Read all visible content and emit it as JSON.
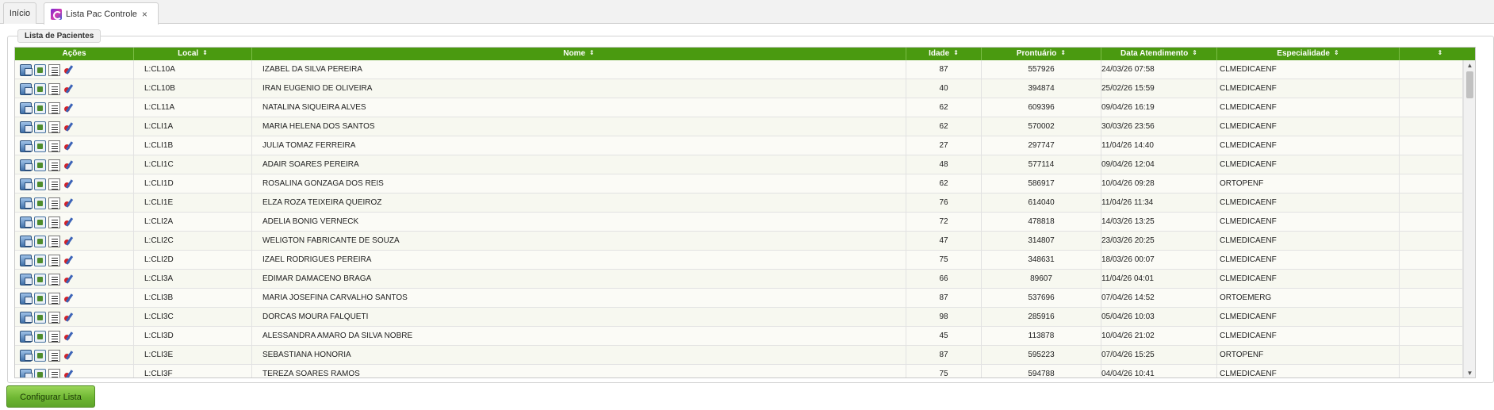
{
  "tabs": [
    {
      "label": "Início"
    },
    {
      "label": "Lista Pac Controle",
      "close": "×"
    }
  ],
  "panel": {
    "legend": "Lista de Pacientes"
  },
  "grid": {
    "columns": [
      {
        "label": "Ações"
      },
      {
        "label": "Local",
        "sort": "⇕"
      },
      {
        "label": "Nome",
        "sort": "⇕"
      },
      {
        "label": "Idade",
        "sort": "⇕"
      },
      {
        "label": "Prontuário",
        "sort": "⇕"
      },
      {
        "label": "Data Atendimento",
        "sort": "⇕"
      },
      {
        "label": "Especialidade",
        "sort": "⇕"
      },
      {
        "label": "",
        "sort": "⇕"
      }
    ],
    "rows": [
      {
        "local": "L:CL10A",
        "nome": "IZABEL DA SILVA PEREIRA",
        "idade": "87",
        "prontuario": "557926",
        "data": "24/03/26 07:58",
        "especialidade": "CLMEDICAENF"
      },
      {
        "local": "L:CL10B",
        "nome": "IRAN EUGENIO DE OLIVEIRA",
        "idade": "40",
        "prontuario": "394874",
        "data": "25/02/26 15:59",
        "especialidade": "CLMEDICAENF"
      },
      {
        "local": "L:CL11A",
        "nome": "NATALINA SIQUEIRA ALVES",
        "idade": "62",
        "prontuario": "609396",
        "data": "09/04/26 16:19",
        "especialidade": "CLMEDICAENF"
      },
      {
        "local": "L:CLI1A",
        "nome": "MARIA HELENA DOS SANTOS",
        "idade": "62",
        "prontuario": "570002",
        "data": "30/03/26 23:56",
        "especialidade": "CLMEDICAENF"
      },
      {
        "local": "L:CLI1B",
        "nome": "JULIA TOMAZ FERREIRA",
        "idade": "27",
        "prontuario": "297747",
        "data": "11/04/26 14:40",
        "especialidade": "CLMEDICAENF"
      },
      {
        "local": "L:CLI1C",
        "nome": "ADAIR SOARES PEREIRA",
        "idade": "48",
        "prontuario": "577114",
        "data": "09/04/26 12:04",
        "especialidade": "CLMEDICAENF"
      },
      {
        "local": "L:CLI1D",
        "nome": "ROSALINA GONZAGA DOS REIS",
        "idade": "62",
        "prontuario": "586917",
        "data": "10/04/26 09:28",
        "especialidade": "ORTOPENF"
      },
      {
        "local": "L:CLI1E",
        "nome": "ELZA ROZA TEIXEIRA QUEIROZ",
        "idade": "76",
        "prontuario": "614040",
        "data": "11/04/26 11:34",
        "especialidade": "CLMEDICAENF"
      },
      {
        "local": "L:CLI2A",
        "nome": "ADELIA BONIG VERNECK",
        "idade": "72",
        "prontuario": "478818",
        "data": "14/03/26 13:25",
        "especialidade": "CLMEDICAENF"
      },
      {
        "local": "L:CLI2C",
        "nome": "WELIGTON FABRICANTE DE SOUZA",
        "idade": "47",
        "prontuario": "314807",
        "data": "23/03/26 20:25",
        "especialidade": "CLMEDICAENF"
      },
      {
        "local": "L:CLI2D",
        "nome": "IZAEL RODRIGUES PEREIRA",
        "idade": "75",
        "prontuario": "348631",
        "data": "18/03/26 00:07",
        "especialidade": "CLMEDICAENF"
      },
      {
        "local": "L:CLI3A",
        "nome": "EDIMAR DAMACENO BRAGA",
        "idade": "66",
        "prontuario": "89607",
        "data": "11/04/26 04:01",
        "especialidade": "CLMEDICAENF"
      },
      {
        "local": "L:CLI3B",
        "nome": "MARIA JOSEFINA CARVALHO SANTOS",
        "idade": "87",
        "prontuario": "537696",
        "data": "07/04/26 14:52",
        "especialidade": "ORTOEMERG"
      },
      {
        "local": "L:CLI3C",
        "nome": "DORCAS MOURA FALQUETI",
        "idade": "98",
        "prontuario": "285916",
        "data": "05/04/26 10:03",
        "especialidade": "CLMEDICAENF"
      },
      {
        "local": "L:CLI3D",
        "nome": "ALESSANDRA AMARO DA SILVA NOBRE",
        "idade": "45",
        "prontuario": "113878",
        "data": "10/04/26 21:02",
        "especialidade": "CLMEDICAENF"
      },
      {
        "local": "L:CLI3E",
        "nome": "SEBASTIANA HONORIA",
        "idade": "87",
        "prontuario": "595223",
        "data": "07/04/26 15:25",
        "especialidade": "ORTOPENF"
      },
      {
        "local": "L:CLI3F",
        "nome": "TEREZA SOARES RAMOS",
        "idade": "75",
        "prontuario": "594788",
        "data": "04/04/26 10:41",
        "especialidade": "CLMEDICAENF"
      }
    ],
    "action_icons": [
      "window-view-icon",
      "document-icon",
      "list-icon",
      "stethoscope-icon"
    ],
    "scroll": {
      "up": "▲",
      "down": "▼"
    }
  },
  "buttons": {
    "configurar_lista": "Configurar Lista"
  },
  "colors": {
    "header_green": "#4a9a10",
    "button_green": "#6fb733"
  }
}
